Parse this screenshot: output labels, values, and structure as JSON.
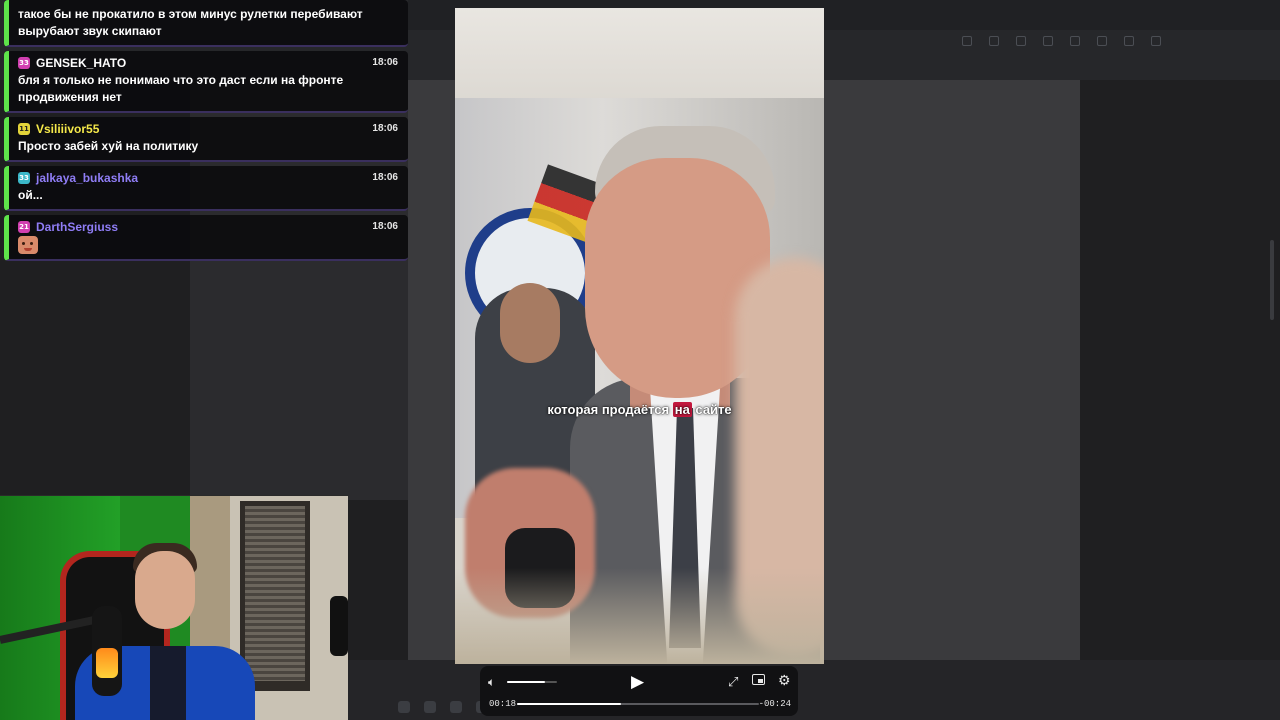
{
  "chat": {
    "messages": [
      {
        "username": "",
        "time": "",
        "badge_text": "",
        "badge_color": "",
        "name_color": "",
        "text": "такое бы не прокатило в этом минус рулетки перебивают вырубают звук скипают"
      },
      {
        "username": "GENSEK_HATO",
        "time": "18:06",
        "badge_text": "33",
        "badge_color": "#d13fb0",
        "name_color": "#ffffff",
        "text": "бля я только не понимаю что это даст если на фронте продвижения нет"
      },
      {
        "username": "Vsiliiivor55",
        "time": "18:06",
        "badge_text": "11",
        "badge_color": "#e3d43a",
        "name_color": "#f5e94a",
        "text": "Просто забей хуй на политику"
      },
      {
        "username": "jalkaya_bukashka",
        "time": "18:06",
        "badge_text": "33",
        "badge_color": "#3bb8c9",
        "name_color": "#8f7df5",
        "text": "ой..."
      },
      {
        "username": "DarthSergiuss",
        "time": "18:06",
        "badge_text": "21",
        "badge_color": "#d13fb0",
        "name_color": "#8f7df5",
        "text": "",
        "emote": "face-emote"
      }
    ],
    "accent_color": "#5ee34a"
  },
  "video": {
    "subtitle_before": "которая продаётся ",
    "subtitle_highlight": "на",
    "subtitle_after": " сайте",
    "highlight_color": "#c3183e"
  },
  "player": {
    "current_time": "00:18",
    "remaining_time": "-00:24",
    "progress": 0.43,
    "volume": 0.75,
    "icons": [
      "volume-icon",
      "play-icon",
      "expand-icon",
      "picture-in-picture-icon",
      "settings-icon"
    ]
  }
}
